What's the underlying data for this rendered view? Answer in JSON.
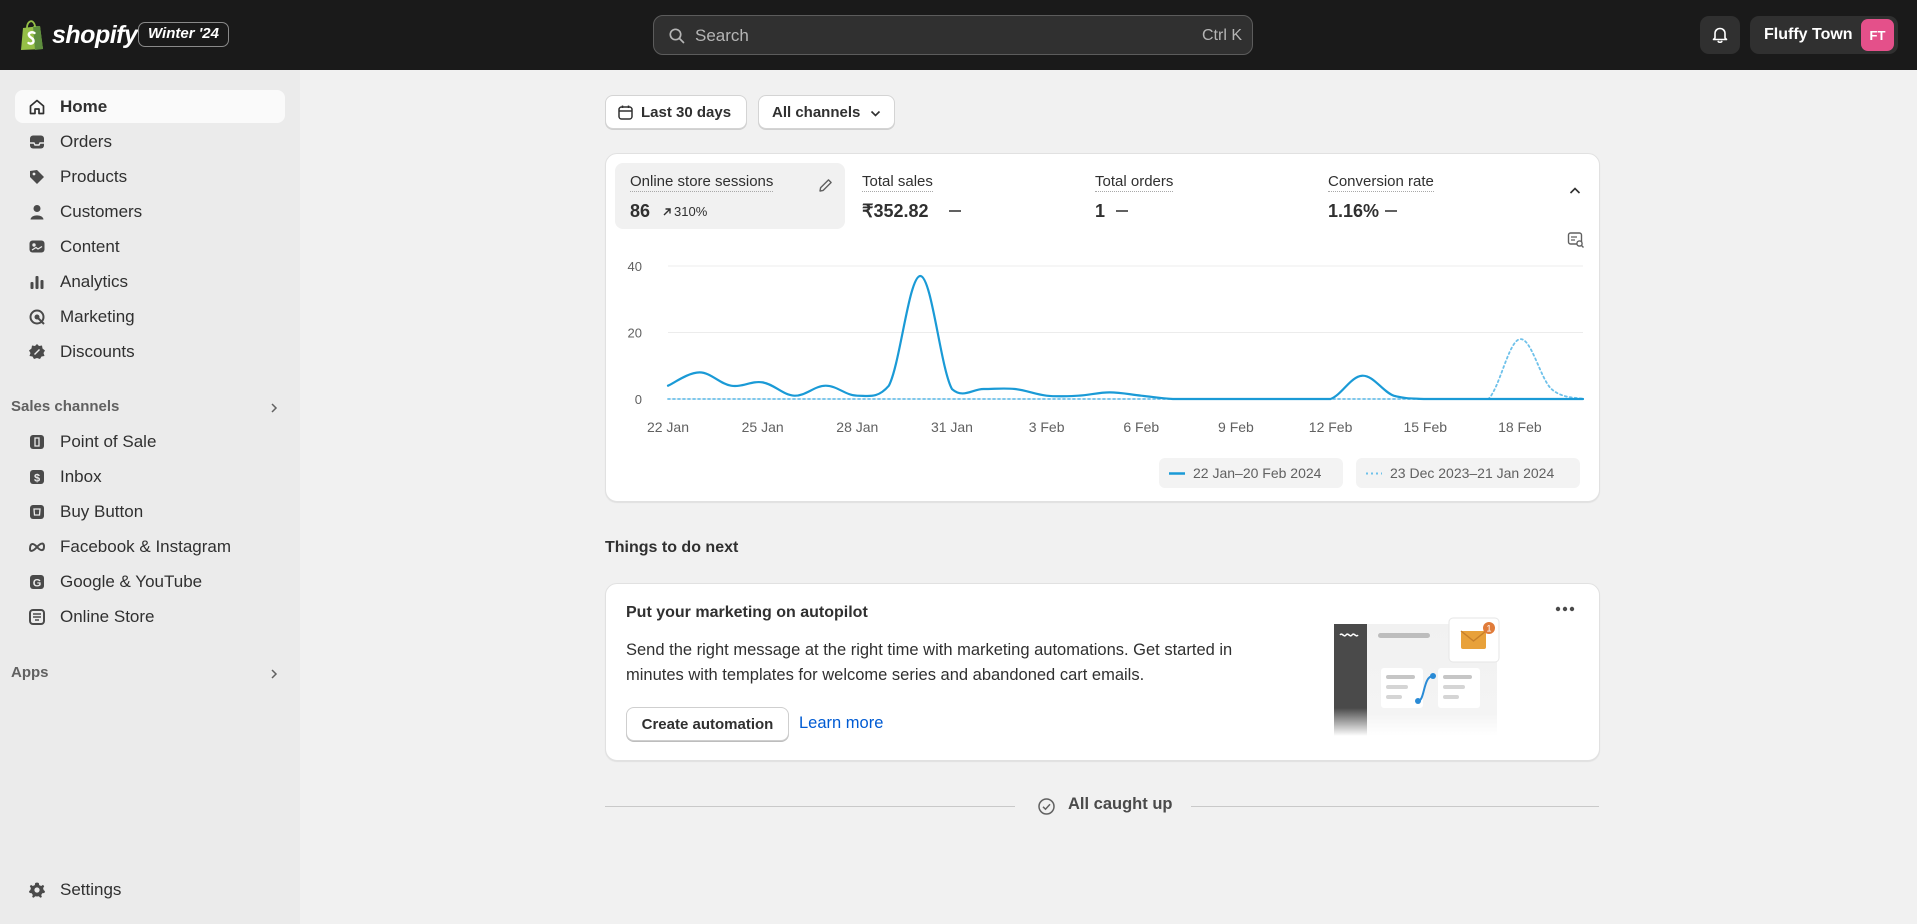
{
  "topbar": {
    "brand": "shopify",
    "edition": "Winter '24",
    "search_placeholder": "Search",
    "search_shortcut": "Ctrl K",
    "store_name": "Fluffy Town",
    "avatar_initials": "FT",
    "avatar_color": "#e4508a"
  },
  "sidebar": {
    "main_items": [
      {
        "label": "Home",
        "icon": "home-icon"
      },
      {
        "label": "Orders",
        "icon": "inbox-icon"
      },
      {
        "label": "Products",
        "icon": "tag-icon"
      },
      {
        "label": "Customers",
        "icon": "person-icon"
      },
      {
        "label": "Content",
        "icon": "content-icon"
      },
      {
        "label": "Analytics",
        "icon": "bar-chart-icon"
      },
      {
        "label": "Marketing",
        "icon": "target-icon"
      },
      {
        "label": "Discounts",
        "icon": "discount-icon"
      }
    ],
    "sales_channels_label": "Sales channels",
    "channels": [
      {
        "label": "Point of Sale",
        "icon": "pos-icon"
      },
      {
        "label": "Inbox",
        "icon": "inbox-chat-icon"
      },
      {
        "label": "Buy Button",
        "icon": "buy-button-icon"
      },
      {
        "label": "Facebook & Instagram",
        "icon": "meta-icon"
      },
      {
        "label": "Google & YouTube",
        "icon": "google-icon"
      },
      {
        "label": "Online Store",
        "icon": "store-icon"
      }
    ],
    "apps_label": "Apps",
    "settings_label": "Settings"
  },
  "filters": {
    "date_range": "Last 30 days",
    "channels": "All channels"
  },
  "metrics": [
    {
      "label": "Online store sessions",
      "value": "86",
      "delta": "310%"
    },
    {
      "label": "Total sales",
      "value": "₹352.82"
    },
    {
      "label": "Total orders",
      "value": "1"
    },
    {
      "label": "Conversion rate",
      "value": "1.16%"
    }
  ],
  "chart_data": {
    "type": "line",
    "x_ticks": [
      "22 Jan",
      "25 Jan",
      "28 Jan",
      "31 Jan",
      "3 Feb",
      "6 Feb",
      "9 Feb",
      "12 Feb",
      "15 Feb",
      "18 Feb"
    ],
    "y_ticks": [
      "40",
      "20",
      "0"
    ],
    "ylim": [
      0,
      40
    ],
    "grid": true,
    "series": [
      {
        "name": "22 Jan–20 Feb 2024",
        "style": "solid",
        "color": "#1a9ad6",
        "values": [
          4,
          8,
          4,
          5,
          1,
          4,
          1,
          4,
          37,
          3,
          3,
          3,
          1,
          1,
          2,
          1,
          0,
          0,
          0,
          0,
          0,
          0,
          7,
          1,
          0,
          0,
          0,
          0,
          0,
          0
        ]
      },
      {
        "name": "23 Dec 2023–21 Jan 2024",
        "style": "dotted",
        "color": "#6ec1ea",
        "values": [
          0,
          0,
          0,
          0,
          0,
          0,
          0,
          0,
          0,
          0,
          0,
          0,
          0,
          0,
          0,
          0,
          0,
          0,
          0,
          0,
          0,
          0,
          0,
          0,
          0,
          0,
          0,
          18,
          3,
          0
        ]
      }
    ]
  },
  "things": {
    "title": "Things to do next",
    "card_title": "Put your marketing on autopilot",
    "card_body": "Send the right message at the right time with marketing automations. Get started in minutes with templates for welcome series and abandoned cart emails.",
    "primary_button": "Create automation",
    "link": "Learn more",
    "badge_count": "1"
  },
  "footer": {
    "caught_up": "All caught up"
  }
}
